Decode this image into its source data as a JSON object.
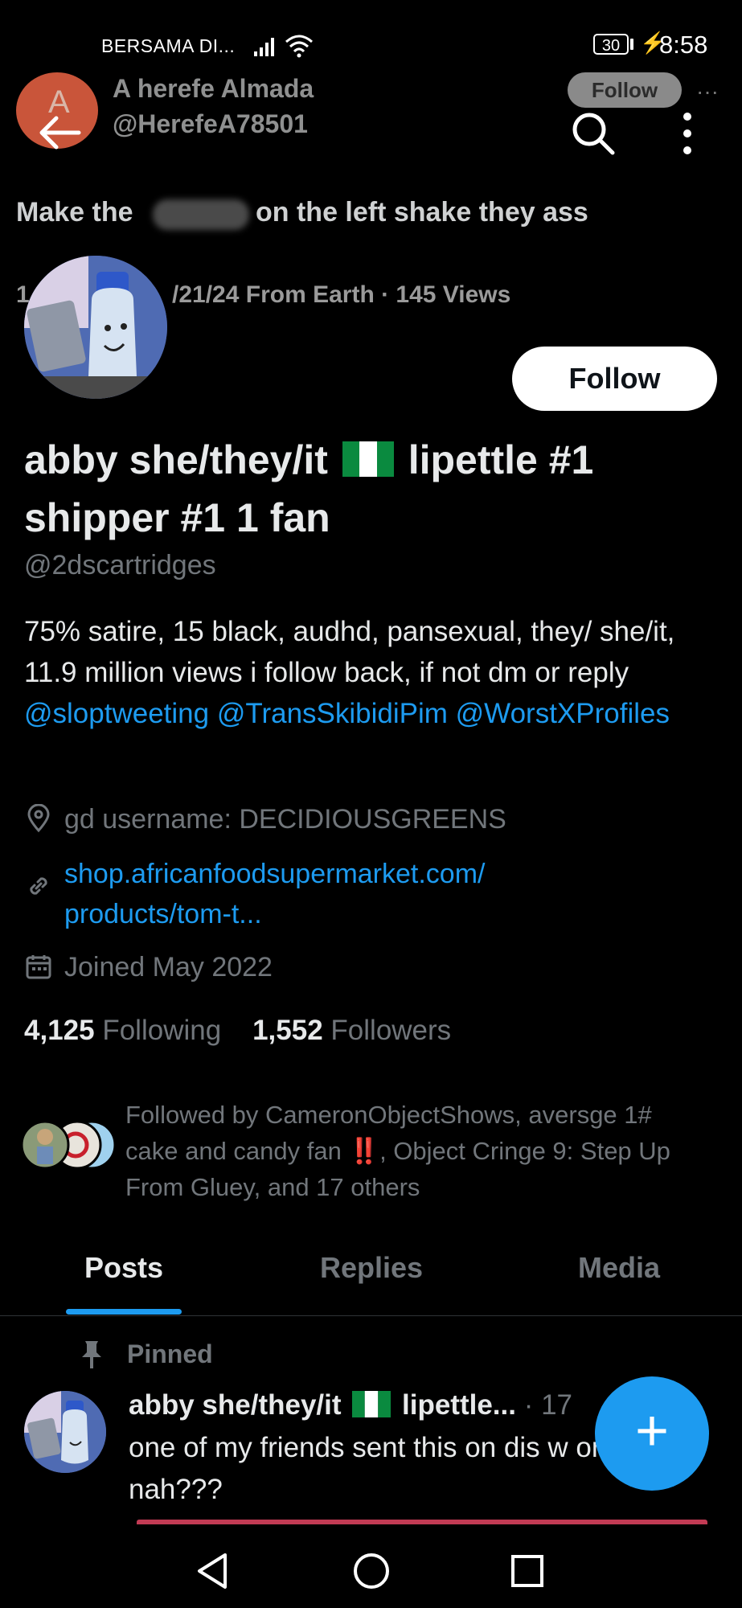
{
  "status_bar": {
    "carrier": "BERSAMA DI...",
    "battery": "30",
    "time": "8:58"
  },
  "quoted_tweet": {
    "author_name": "A herefe Almada",
    "author_handle": "@HerefeA78501",
    "avatar_letter": "A",
    "follow_label": "Follow",
    "text_before": "Make the",
    "text_after": "on the left shake they ass",
    "meta_lead": "1",
    "meta": "/21/24 From Earth · 145 Views"
  },
  "profile": {
    "follow_label": "Follow",
    "name_part1": "abby she/they/it",
    "name_part2": "lipettle #1",
    "name_line2": "shipper #1 1 fan",
    "handle": "@2dscartridges",
    "bio_text": "75% satire, 15 black, audhd, pansexual, they/ she/it, 11.9 million views  i follow back, if not dm or reply ",
    "bio_mentions": [
      "@sloptweeting",
      "@TransSkibidiPim",
      "@WorstXProfiles"
    ],
    "location": "gd username: DECIDIOUSGREENS",
    "url_line1": "shop.africanfoodsupermarket.com/",
    "url_line2": "products/tom-t...",
    "joined": "Joined May 2022",
    "following_count": "4,125",
    "following_label": "Following",
    "followers_count": "1,552",
    "followers_label": "Followers",
    "followed_by": "Followed by CameronObjectShows, aversge 1# cake and candy fan ‼️, Object Cringe 9: Step Up From Gluey, and 17 others"
  },
  "tabs": [
    "Posts",
    "Replies",
    "Media"
  ],
  "active_tab": "Posts",
  "pinned_post": {
    "pinned_label": "Pinned",
    "name": "abby she/they/it",
    "name_suffix": "lipettle...",
    "time": "· 17",
    "text": "one of my friends sent this on dis w or nah???"
  },
  "fab_label": "+",
  "colors": {
    "accent": "#1d9bf0",
    "background": "#000000",
    "muted": "#71767b"
  }
}
